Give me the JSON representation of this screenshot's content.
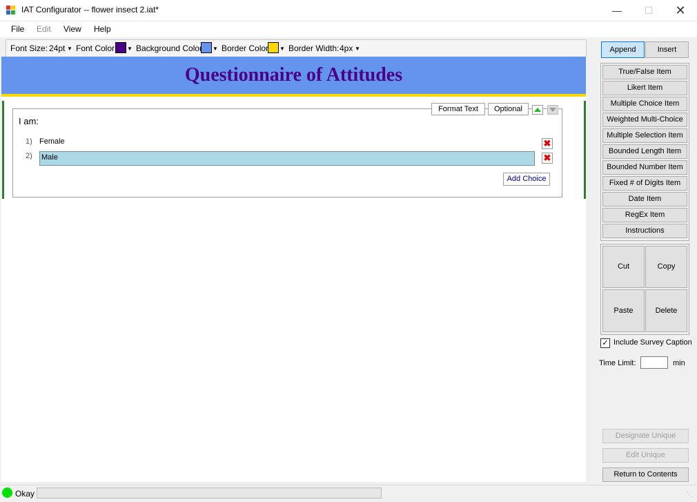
{
  "window": {
    "title": "IAT Configurator -- flower insect 2.iat*"
  },
  "menu": {
    "file": "File",
    "edit": "Edit",
    "view": "View",
    "help": "Help"
  },
  "toolbar": {
    "font_size_label": "Font Size:",
    "font_size_value": "24pt",
    "font_color_label": "Font Color:",
    "font_color": "#4b0082",
    "bg_color_label": "Background Color:",
    "bg_color": "#6495ed",
    "border_color_label": "Border Color:",
    "border_color": "#ffd700",
    "border_width_label": "Border Width:",
    "border_width_value": "4px"
  },
  "survey": {
    "caption": "Questionnaire of Attitudes",
    "item": {
      "format_text": "Format Text",
      "optional": "Optional",
      "question": "I am:",
      "choices": [
        {
          "num": "1)",
          "text": "Female"
        },
        {
          "num": "2)",
          "text": "Male"
        }
      ],
      "add_choice": "Add Choice"
    }
  },
  "panel": {
    "append": "Append",
    "insert": "Insert",
    "items": [
      "True/False Item",
      "Likert Item",
      "Multiple Choice Item",
      "Weighted Multi-Choice",
      "Multiple Selection Item",
      "Bounded Length Item",
      "Bounded Number Item",
      "Fixed # of Digits Item",
      "Date Item",
      "RegEx Item",
      "Instructions"
    ],
    "cut": "Cut",
    "copy": "Copy",
    "paste": "Paste",
    "delete": "Delete",
    "include_caption": "Include Survey Caption",
    "time_limit_label": "Time Limit:",
    "time_limit_value": "",
    "time_unit": "min",
    "designate_unique": "Designate Unique",
    "edit_unique": "Edit Unique",
    "return_contents": "Return to Contents"
  },
  "status": {
    "text": "Okay",
    "indicator_color": "#00e000"
  }
}
